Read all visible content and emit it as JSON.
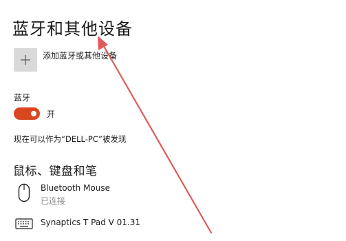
{
  "page": {
    "title": "蓝牙和其他设备"
  },
  "add_device": {
    "label": "添加蓝牙或其他设备",
    "icon": "plus-icon"
  },
  "bluetooth": {
    "label": "蓝牙",
    "toggle_state": "开",
    "toggle_on": true,
    "accent_color": "#d9471f",
    "discoverable_text": "现在可以作为“DELL-PC”被发现"
  },
  "section": {
    "heading": "鼠标、键盘和笔"
  },
  "devices": [
    {
      "name": "Bluetooth Mouse",
      "status": "已连接",
      "icon": "mouse-icon"
    },
    {
      "name": "Synaptics T Pad V 01.31",
      "status": "",
      "icon": "keyboard-icon"
    }
  ],
  "annotation": {
    "arrow_color": "#e05a5a"
  }
}
